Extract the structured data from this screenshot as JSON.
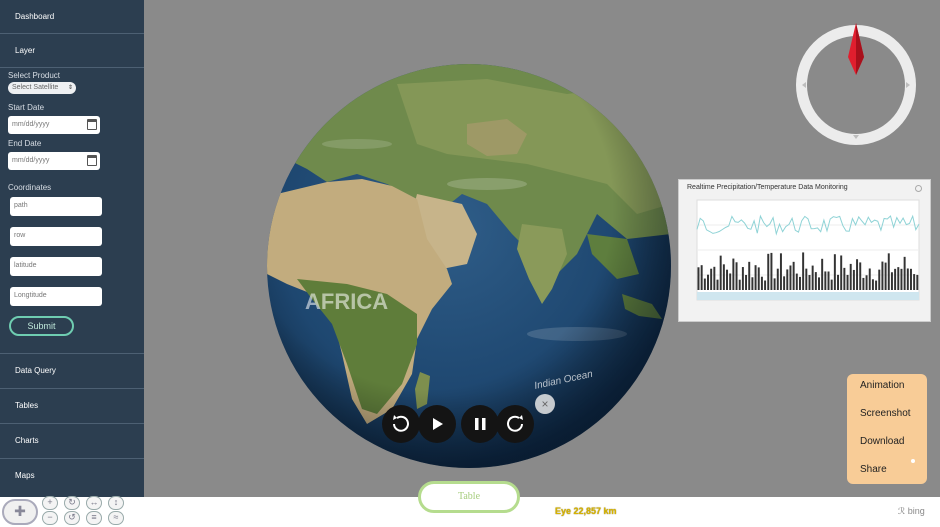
{
  "sidebar": {
    "dashboard": "Dashboard",
    "layer": "Layer",
    "select_product_label": "Select Product",
    "select_product_value": "Select Satellite",
    "start_date_label": "Start Date",
    "start_date_placeholder": "mm/dd/yyyy",
    "end_date_label": "End Date",
    "end_date_placeholder": "mm/dd/yyyy",
    "coordinates_label": "Coordinates",
    "fields": [
      "path",
      "row",
      "latitude",
      "Longtitude"
    ],
    "submit": "Submit",
    "menu": [
      "Data Query",
      "Tables",
      "Charts",
      "Maps"
    ]
  },
  "globe": {
    "labels": [
      "AFRICA",
      "Indian Ocean"
    ]
  },
  "chart": {
    "title": "Realtime Precipitation/Temperature Data Monitoring"
  },
  "context_menu": [
    "Animation",
    "Screenshot",
    "Download",
    "Share"
  ],
  "table_button": "Table",
  "status": {
    "eye": "Eye  22,857 km",
    "bing": "bing"
  },
  "colors": {
    "sidebar": "#2c3e50",
    "accent_green": "#6fcdb1",
    "menu_bg": "#f8cc97",
    "compass_needle": "#e01e2e"
  }
}
